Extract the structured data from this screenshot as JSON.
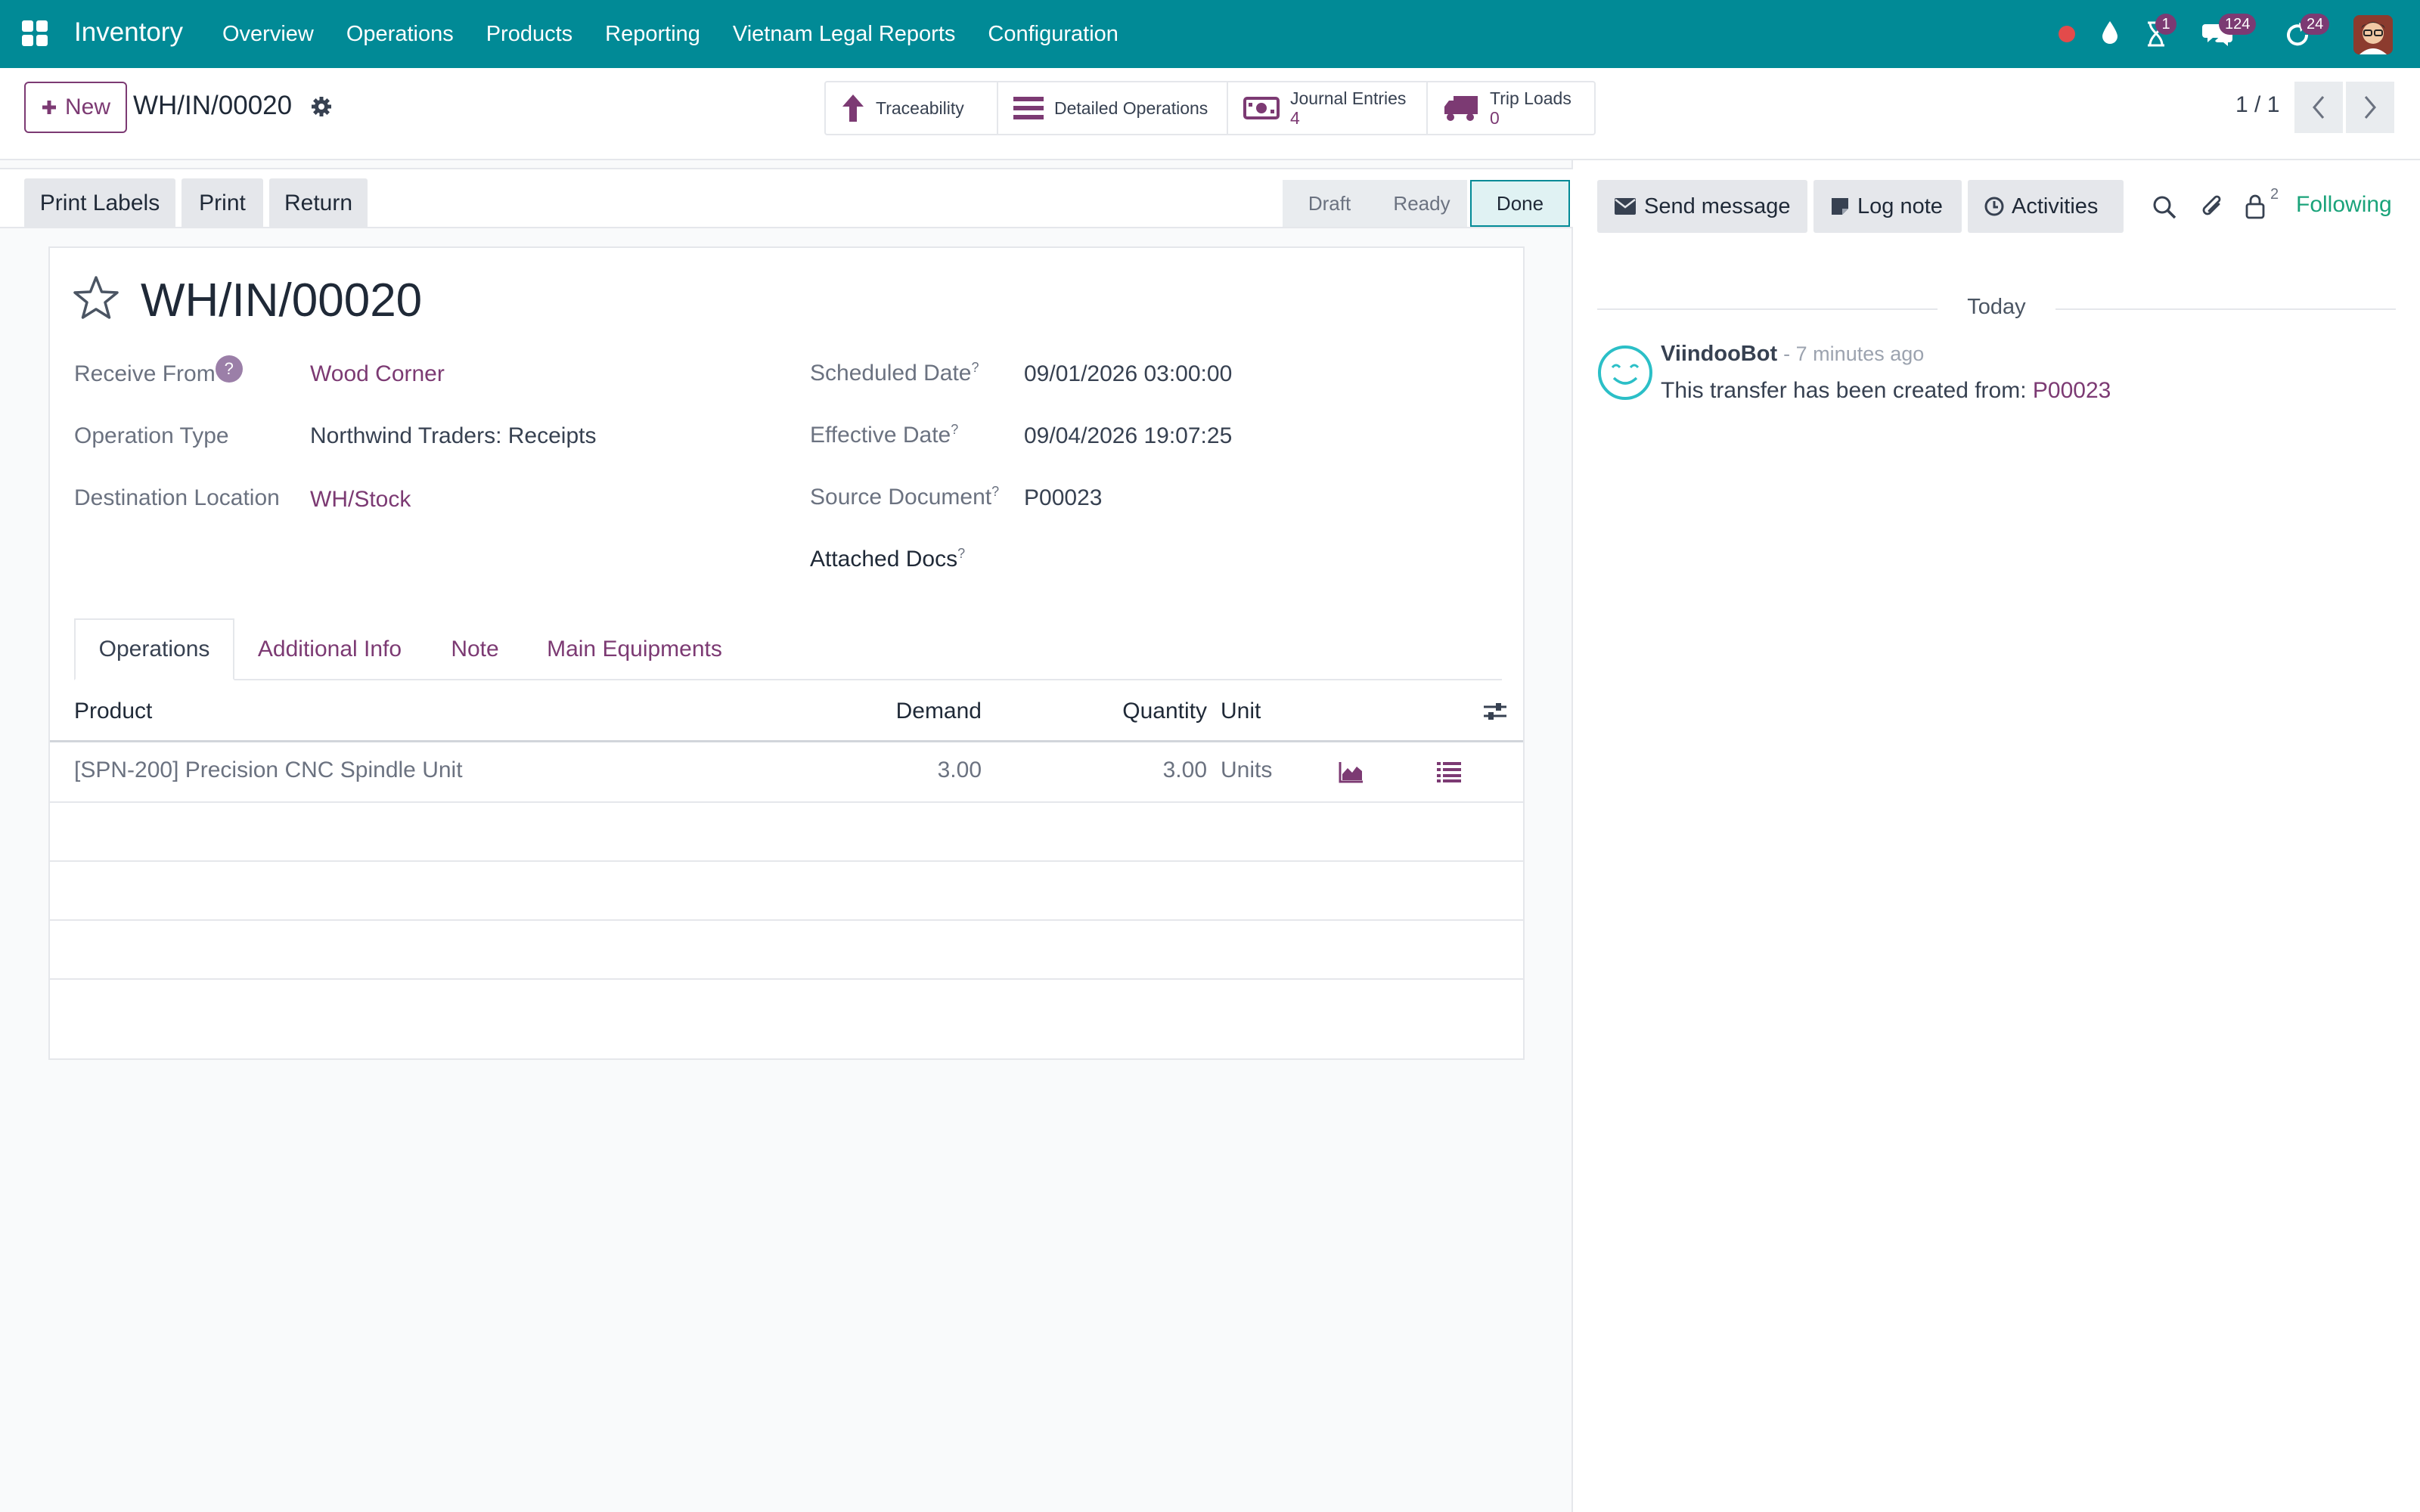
{
  "navbar": {
    "app_name": "Inventory",
    "menu": [
      "Overview",
      "Operations",
      "Products",
      "Reporting",
      "Vietnam Legal Reports",
      "Configuration"
    ],
    "activities_count": "1",
    "messages_count": "124",
    "updates_count": "24",
    "bg_color": "#018a96"
  },
  "control_panel": {
    "new_label": "New",
    "breadcrumb": "WH/IN/00020",
    "smart_buttons": {
      "traceability": "Traceability",
      "detailed_operations": "Detailed Operations",
      "journal_entries_label": "Journal Entries",
      "journal_entries_count": "4",
      "trip_loads_label": "Trip Loads",
      "trip_loads_count": "0"
    },
    "pager": "1 / 1"
  },
  "statusbar": {
    "actions": [
      "Print Labels",
      "Print",
      "Return"
    ],
    "stages": [
      "Draft",
      "Ready",
      "Done"
    ],
    "current_stage": "Done"
  },
  "form": {
    "title": "WH/IN/00020",
    "receive_from_label": "Receive From",
    "receive_from_help": "?",
    "receive_from": "Wood Corner",
    "operation_type_label": "Operation Type",
    "operation_type": "Northwind Traders: Receipts",
    "destination_label": "Destination Location",
    "destination": "WH/Stock",
    "scheduled_date_label": "Scheduled Date",
    "scheduled_date": "09/01/2026 03:00:00",
    "effective_date_label": "Effective Date",
    "effective_date": "09/04/2026 19:07:25",
    "source_document_label": "Source Document",
    "source_document": "P00023",
    "attached_docs_label": "Attached Docs",
    "help_mark": "?"
  },
  "tabs": [
    "Operations",
    "Additional Info",
    "Note",
    "Main Equipments"
  ],
  "operations_table": {
    "columns": {
      "product": "Product",
      "demand": "Demand",
      "quantity": "Quantity",
      "unit": "Unit"
    },
    "rows": [
      {
        "product": "[SPN-200] Precision CNC Spindle Unit",
        "demand": "3.00",
        "quantity": "3.00",
        "unit": "Units"
      }
    ]
  },
  "chatter": {
    "send_message": "Send message",
    "log_note": "Log note",
    "activities": "Activities",
    "followers_count": "2",
    "following": "Following",
    "date_separator": "Today",
    "message": {
      "author": "ViindooBot",
      "time": "- 7 minutes ago",
      "body": "This transfer has been created from:",
      "link": "P00023"
    }
  }
}
